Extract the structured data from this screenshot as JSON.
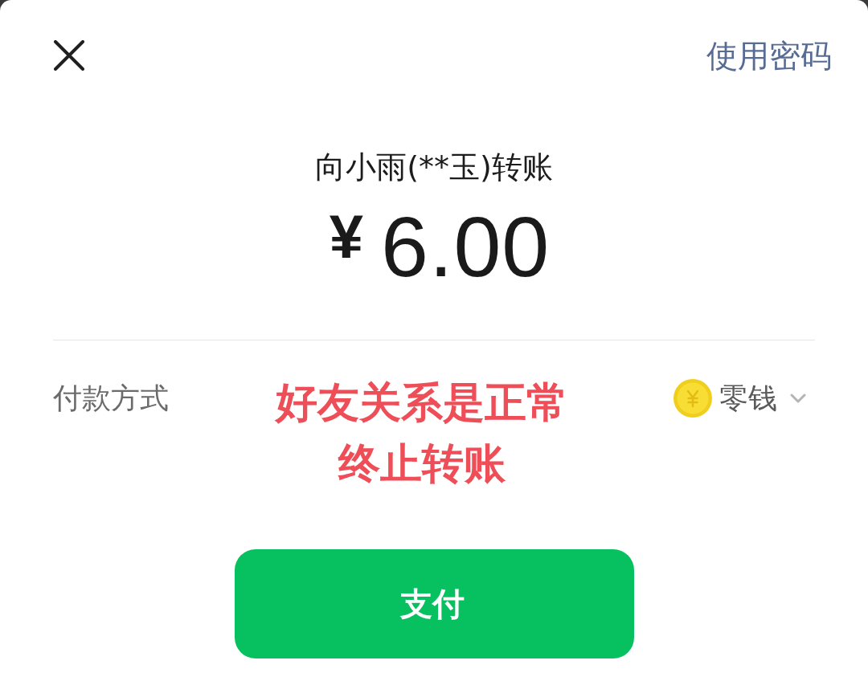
{
  "header": {
    "password_link": "使用密码"
  },
  "transfer": {
    "title": "向小雨(**玉)转账",
    "currency": "¥",
    "amount": "6.00"
  },
  "payment_method": {
    "label": "付款方式",
    "method": "零钱"
  },
  "annotation": {
    "lines": [
      "好友关系是正常",
      "终止转账"
    ]
  },
  "pay_button": {
    "label": "支付"
  }
}
